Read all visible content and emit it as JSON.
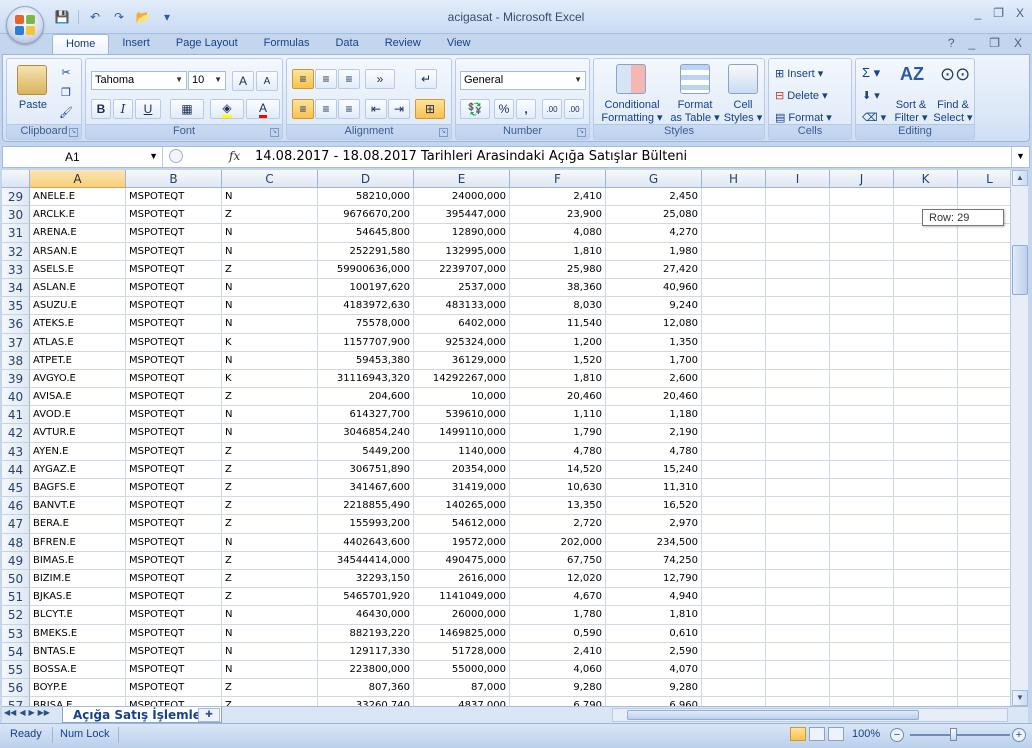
{
  "window": {
    "title": "acigasat - Microsoft Excel",
    "minimize": "_",
    "restore": "❐",
    "close": "X"
  },
  "qat": {
    "save": "💾",
    "undo": "↶",
    "redo": "↷",
    "open": "📂",
    "more": "▾"
  },
  "tabs": [
    "Home",
    "Insert",
    "Page Layout",
    "Formulas",
    "Data",
    "Review",
    "View"
  ],
  "ribbon": {
    "clipboard": {
      "label": "Clipboard",
      "paste": "Paste"
    },
    "font": {
      "label": "Font",
      "name": "Tahoma",
      "size": "10",
      "grow": "A",
      "shrink": "A",
      "bold": "B",
      "italic": "I",
      "underline": "U"
    },
    "alignment": {
      "label": "Alignment"
    },
    "number": {
      "label": "Number",
      "format": "General",
      "percent": "%",
      "comma": ",",
      "inc": ".00",
      "dec": ".00"
    },
    "styles": {
      "label": "Styles",
      "conditional": [
        "Conditional",
        "Formatting ▾"
      ],
      "format_table": [
        "Format",
        "as Table ▾"
      ],
      "cell_styles": [
        "Cell",
        "Styles ▾"
      ]
    },
    "cells": {
      "label": "Cells",
      "insert": "Insert ▾",
      "delete": "Delete ▾",
      "format": "Format ▾"
    },
    "editing": {
      "label": "Editing",
      "sum": "Σ ▾",
      "sort_filter": [
        "Sort &",
        "Filter ▾"
      ],
      "find_select": [
        "Find &",
        "Select ▾"
      ]
    }
  },
  "formula_bar": {
    "name_box": "A1",
    "fx": "fx",
    "content": "14.08.2017 - 18.08.2017 Tarihleri Arasindaki Açığa Satışlar Bülteni"
  },
  "columns": [
    "A",
    "B",
    "C",
    "D",
    "E",
    "F",
    "G",
    "H",
    "I",
    "J",
    "K",
    "L"
  ],
  "rows": [
    {
      "n": "29",
      "a": "ANELE.E",
      "b": "MSPOTEQT",
      "c": "N",
      "d": "58210,000",
      "e": "24000,000",
      "f": "2,410",
      "g": "2,450"
    },
    {
      "n": "30",
      "a": "ARCLK.E",
      "b": "MSPOTEQT",
      "c": "Z",
      "d": "9676670,200",
      "e": "395447,000",
      "f": "23,900",
      "g": "25,080"
    },
    {
      "n": "31",
      "a": "ARENA.E",
      "b": "MSPOTEQT",
      "c": "N",
      "d": "54645,800",
      "e": "12890,000",
      "f": "4,080",
      "g": "4,270"
    },
    {
      "n": "32",
      "a": "ARSAN.E",
      "b": "MSPOTEQT",
      "c": "N",
      "d": "252291,580",
      "e": "132995,000",
      "f": "1,810",
      "g": "1,980"
    },
    {
      "n": "33",
      "a": "ASELS.E",
      "b": "MSPOTEQT",
      "c": "Z",
      "d": "59900636,000",
      "e": "2239707,000",
      "f": "25,980",
      "g": "27,420"
    },
    {
      "n": "34",
      "a": "ASLAN.E",
      "b": "MSPOTEQT",
      "c": "N",
      "d": "100197,620",
      "e": "2537,000",
      "f": "38,360",
      "g": "40,960"
    },
    {
      "n": "35",
      "a": "ASUZU.E",
      "b": "MSPOTEQT",
      "c": "N",
      "d": "4183972,630",
      "e": "483133,000",
      "f": "8,030",
      "g": "9,240"
    },
    {
      "n": "36",
      "a": "ATEKS.E",
      "b": "MSPOTEQT",
      "c": "N",
      "d": "75578,000",
      "e": "6402,000",
      "f": "11,540",
      "g": "12,080"
    },
    {
      "n": "37",
      "a": "ATLAS.E",
      "b": "MSPOTEQT",
      "c": "K",
      "d": "1157707,900",
      "e": "925324,000",
      "f": "1,200",
      "g": "1,350"
    },
    {
      "n": "38",
      "a": "ATPET.E",
      "b": "MSPOTEQT",
      "c": "N",
      "d": "59453,380",
      "e": "36129,000",
      "f": "1,520",
      "g": "1,700"
    },
    {
      "n": "39",
      "a": "AVGYO.E",
      "b": "MSPOTEQT",
      "c": "K",
      "d": "31116943,320",
      "e": "14292267,000",
      "f": "1,810",
      "g": "2,600"
    },
    {
      "n": "40",
      "a": "AVISA.E",
      "b": "MSPOTEQT",
      "c": "Z",
      "d": "204,600",
      "e": "10,000",
      "f": "20,460",
      "g": "20,460"
    },
    {
      "n": "41",
      "a": "AVOD.E",
      "b": "MSPOTEQT",
      "c": "N",
      "d": "614327,700",
      "e": "539610,000",
      "f": "1,110",
      "g": "1,180"
    },
    {
      "n": "42",
      "a": "AVTUR.E",
      "b": "MSPOTEQT",
      "c": "N",
      "d": "3046854,240",
      "e": "1499110,000",
      "f": "1,790",
      "g": "2,190"
    },
    {
      "n": "43",
      "a": "AYEN.E",
      "b": "MSPOTEQT",
      "c": "Z",
      "d": "5449,200",
      "e": "1140,000",
      "f": "4,780",
      "g": "4,780"
    },
    {
      "n": "44",
      "a": "AYGAZ.E",
      "b": "MSPOTEQT",
      "c": "Z",
      "d": "306751,890",
      "e": "20354,000",
      "f": "14,520",
      "g": "15,240"
    },
    {
      "n": "45",
      "a": "BAGFS.E",
      "b": "MSPOTEQT",
      "c": "Z",
      "d": "341467,600",
      "e": "31419,000",
      "f": "10,630",
      "g": "11,310"
    },
    {
      "n": "46",
      "a": "BANVT.E",
      "b": "MSPOTEQT",
      "c": "Z",
      "d": "2218855,490",
      "e": "140265,000",
      "f": "13,350",
      "g": "16,520"
    },
    {
      "n": "47",
      "a": "BERA.E",
      "b": "MSPOTEQT",
      "c": "Z",
      "d": "155993,200",
      "e": "54612,000",
      "f": "2,720",
      "g": "2,970"
    },
    {
      "n": "48",
      "a": "BFREN.E",
      "b": "MSPOTEQT",
      "c": "N",
      "d": "4402643,600",
      "e": "19572,000",
      "f": "202,000",
      "g": "234,500"
    },
    {
      "n": "49",
      "a": "BIMAS.E",
      "b": "MSPOTEQT",
      "c": "Z",
      "d": "34544414,000",
      "e": "490475,000",
      "f": "67,750",
      "g": "74,250"
    },
    {
      "n": "50",
      "a": "BIZIM.E",
      "b": "MSPOTEQT",
      "c": "Z",
      "d": "32293,150",
      "e": "2616,000",
      "f": "12,020",
      "g": "12,790"
    },
    {
      "n": "51",
      "a": "BJKAS.E",
      "b": "MSPOTEQT",
      "c": "Z",
      "d": "5465701,920",
      "e": "1141049,000",
      "f": "4,670",
      "g": "4,940"
    },
    {
      "n": "52",
      "a": "BLCYT.E",
      "b": "MSPOTEQT",
      "c": "N",
      "d": "46430,000",
      "e": "26000,000",
      "f": "1,780",
      "g": "1,810"
    },
    {
      "n": "53",
      "a": "BMEKS.E",
      "b": "MSPOTEQT",
      "c": "N",
      "d": "882193,220",
      "e": "1469825,000",
      "f": "0,590",
      "g": "0,610"
    },
    {
      "n": "54",
      "a": "BNTAS.E",
      "b": "MSPOTEQT",
      "c": "N",
      "d": "129117,330",
      "e": "51728,000",
      "f": "2,410",
      "g": "2,590"
    },
    {
      "n": "55",
      "a": "BOSSA.E",
      "b": "MSPOTEQT",
      "c": "N",
      "d": "223800,000",
      "e": "55000,000",
      "f": "4,060",
      "g": "4,070"
    },
    {
      "n": "56",
      "a": "BOYP.E",
      "b": "MSPOTEQT",
      "c": "Z",
      "d": "807,360",
      "e": "87,000",
      "f": "9,280",
      "g": "9,280"
    },
    {
      "n": "57",
      "a": "BRISA.E",
      "b": "MSPOTEQT",
      "c": "Z",
      "d": "33260,740",
      "e": "4837,000",
      "f": "6,790",
      "g": "6,960"
    }
  ],
  "row_tooltip": "Row: 29",
  "sheet": {
    "tab_name": "Açığa Satış İşlemleri"
  },
  "status": {
    "ready": "Ready",
    "numlock": "Num Lock",
    "zoom": "100%",
    "zoom_out": "−",
    "zoom_in": "+"
  }
}
